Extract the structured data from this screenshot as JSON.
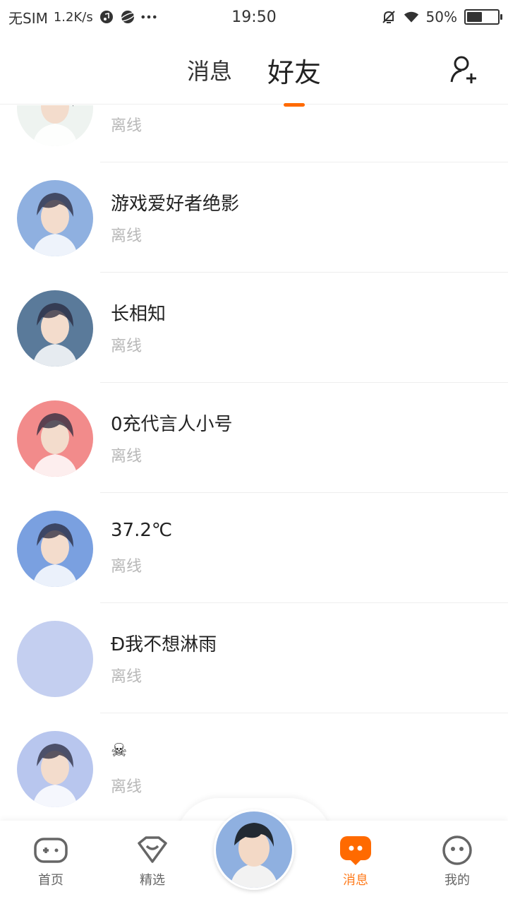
{
  "status_bar": {
    "carrier": "无SIM",
    "speed": "1.2K/s",
    "time": "19:50",
    "battery": "50%",
    "battery_level": 0.5
  },
  "header": {
    "tabs": [
      {
        "label": "消息",
        "active": false
      },
      {
        "label": "好友",
        "active": true
      }
    ]
  },
  "friends": [
    {
      "name": "",
      "status": "离线",
      "avatar_color": "#eef3f0"
    },
    {
      "name": "游戏爱好者绝影",
      "status": "离线",
      "avatar_color": "#8fb0e0"
    },
    {
      "name": "长相知",
      "status": "离线",
      "avatar_color": "#5a7a9a"
    },
    {
      "name": "0充代言人小号",
      "status": "离线",
      "avatar_color": "#f28b8b"
    },
    {
      "name": "37.2℃",
      "status": "离线",
      "avatar_color": "#7aa0e0"
    },
    {
      "name": "Ð我不想淋雨",
      "status": "离线",
      "avatar_color": "#c4cff0"
    },
    {
      "name": "☠",
      "status": "离线",
      "avatar_color": "#b8c6ee"
    }
  ],
  "bottom_nav": {
    "items": [
      {
        "label": "首页",
        "active": false
      },
      {
        "label": "精选",
        "active": false
      },
      {
        "label": "消息",
        "active": true
      },
      {
        "label": "我的",
        "active": false
      }
    ]
  },
  "colors": {
    "accent": "#ff6a00",
    "muted": "#b8b8b8"
  }
}
